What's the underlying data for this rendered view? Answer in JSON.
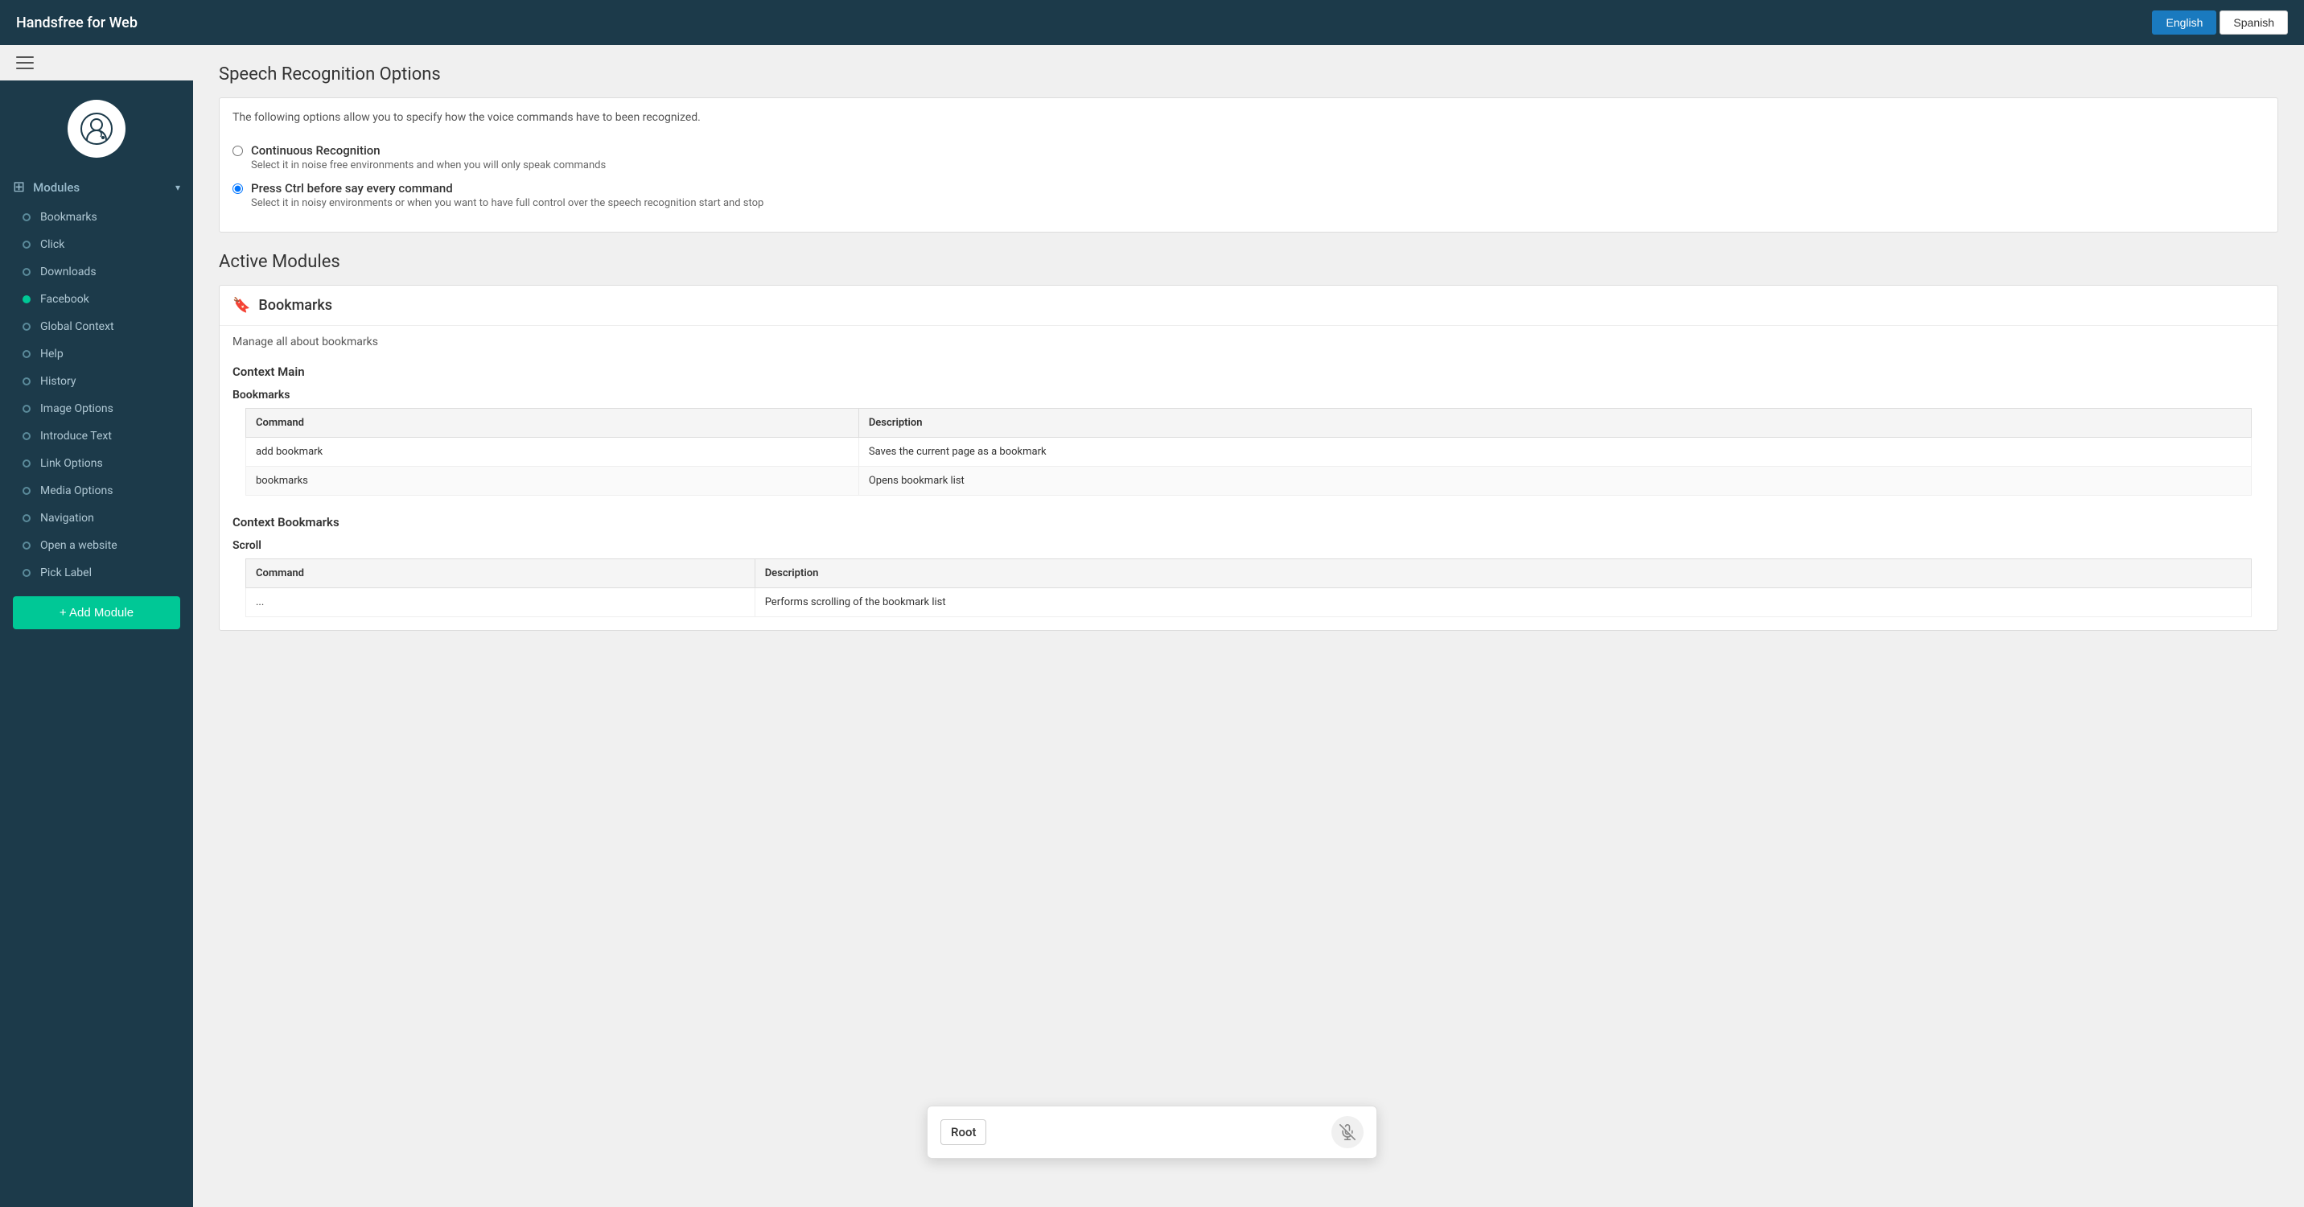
{
  "app": {
    "title": "Handsfree for Web"
  },
  "header": {
    "title": "Handsfree for Web",
    "lang_english": "English",
    "lang_spanish": "Spanish",
    "active_lang": "English"
  },
  "sidebar": {
    "modules_label": "Modules",
    "add_module_label": "+ Add Module",
    "items": [
      {
        "id": "bookmarks",
        "label": "Bookmarks",
        "active": false
      },
      {
        "id": "click",
        "label": "Click",
        "active": false
      },
      {
        "id": "downloads",
        "label": "Downloads",
        "active": false
      },
      {
        "id": "facebook",
        "label": "Facebook",
        "active": true
      },
      {
        "id": "global-context",
        "label": "Global Context",
        "active": false
      },
      {
        "id": "help",
        "label": "Help",
        "active": false
      },
      {
        "id": "history",
        "label": "History",
        "active": false
      },
      {
        "id": "image-options",
        "label": "Image Options",
        "active": false
      },
      {
        "id": "introduce-text",
        "label": "Introduce Text",
        "active": false
      },
      {
        "id": "link-options",
        "label": "Link Options",
        "active": false
      },
      {
        "id": "media-options",
        "label": "Media Options",
        "active": false
      },
      {
        "id": "navigation",
        "label": "Navigation",
        "active": false
      },
      {
        "id": "open-website",
        "label": "Open a website",
        "active": false
      },
      {
        "id": "pick-label",
        "label": "Pick Label",
        "active": false
      }
    ]
  },
  "speech_recognition": {
    "section_title": "Speech Recognition Options",
    "description": "The following options allow you to specify how the voice commands have to been recognized.",
    "options": [
      {
        "id": "continuous",
        "label": "Continuous Recognition",
        "sublabel": "Select it in noise free environments and when you will only speak commands",
        "selected": false
      },
      {
        "id": "press-ctrl",
        "label": "Press Ctrl before say every command",
        "sublabel": "Select it in noisy environments or when you want to have full control over the speech recognition start and stop",
        "selected": true
      }
    ]
  },
  "active_modules": {
    "title": "Active Modules",
    "modules": [
      {
        "id": "bookmarks",
        "name": "Bookmarks",
        "description": "Manage all about bookmarks",
        "contexts": [
          {
            "context_title": "Context Main",
            "context_subtitle": "Bookmarks",
            "commands": [
              {
                "command": "add bookmark",
                "description": "Saves the current page as a bookmark"
              },
              {
                "command": "bookmarks",
                "description": "Opens bookmark list"
              }
            ]
          },
          {
            "context_title": "Context Bookmarks",
            "context_subtitle": "Scroll",
            "commands": [
              {
                "command": "...",
                "description": "Performs scrolling of the bookmark list"
              }
            ]
          }
        ]
      }
    ],
    "table_headers": {
      "command": "Command",
      "description": "Description"
    }
  },
  "voice_input": {
    "root_tag": "Root",
    "placeholder": ""
  }
}
